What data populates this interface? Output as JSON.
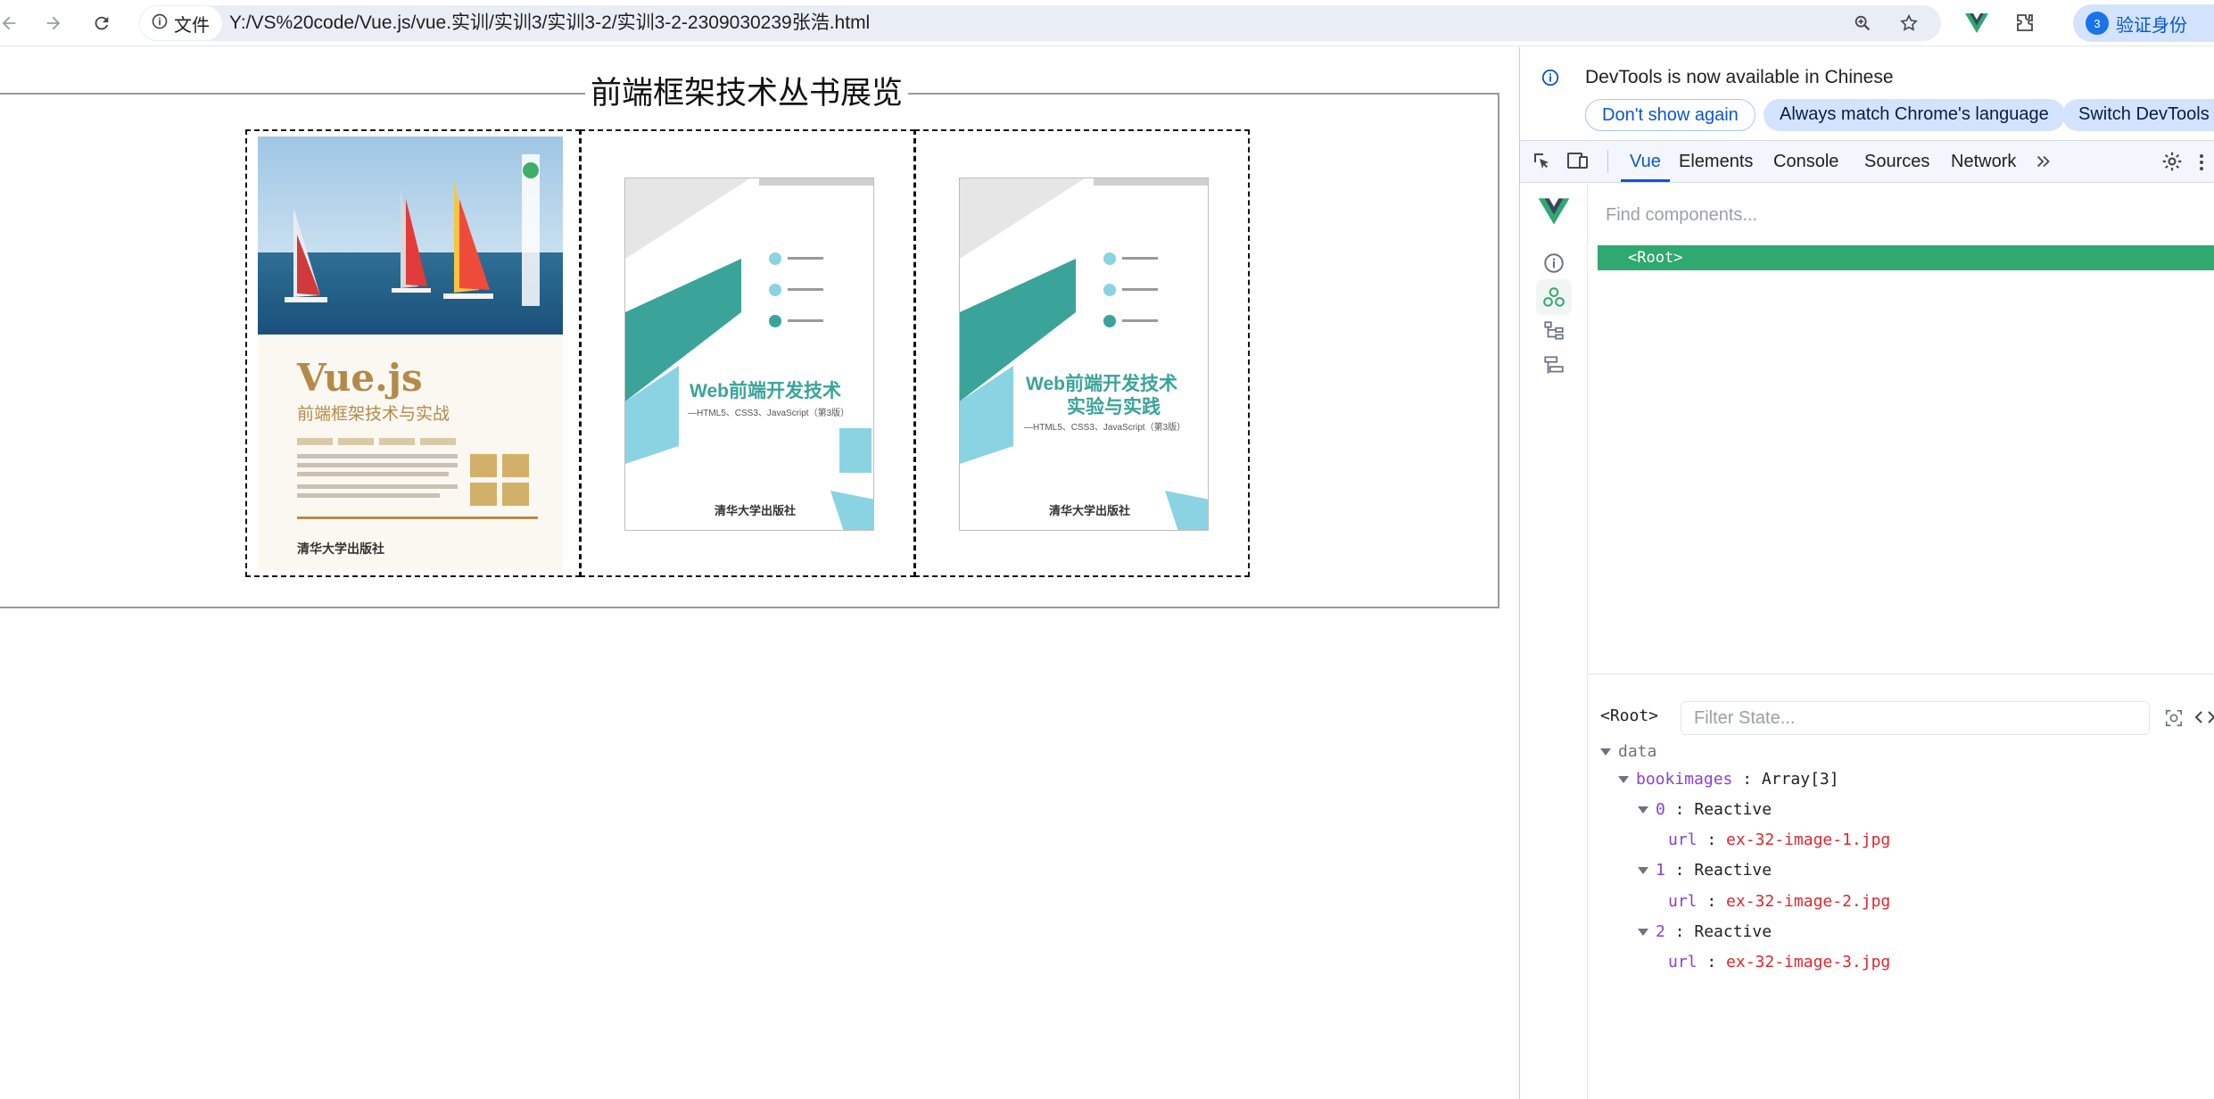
{
  "browser": {
    "site_chip_label": "文件",
    "url": "Y:/VS%20code/Vue.js/vue.实训/实训3/实训3-2/实训3-2-2309030239张浩.html",
    "profile_label": "验证身份",
    "profile_initial": "3"
  },
  "page": {
    "gallery_title": "前端框架技术丛书展览",
    "books": [
      {
        "cover_title": "Vue.js",
        "cover_subtitle": "前端框架技术与实战",
        "publisher": "清华大学出版社"
      },
      {
        "cover_title": "Web前端开发技术",
        "cover_subtitle": "—HTML5、CSS3、JavaScript（第3版）",
        "publisher": "清华大学出版社"
      },
      {
        "cover_title": "Web前端开发技术",
        "cover_title_2": "实验与实践",
        "cover_subtitle": "—HTML5、CSS3、JavaScript（第3版）",
        "publisher": "清华大学出版社"
      }
    ]
  },
  "devtools": {
    "banner_message": "DevTools is now available in Chinese",
    "banner_buttons": [
      "Don't show again",
      "Always match Chrome's language",
      "Switch DevTools t"
    ],
    "tabs": [
      "Vue",
      "Elements",
      "Console",
      "Sources",
      "Network"
    ],
    "active_tab": "Vue",
    "find_placeholder": "Find components...",
    "root_component": "<Root>",
    "state": {
      "tag": "<Root>",
      "filter_placeholder": "Filter State...",
      "section": "data",
      "array_key": "bookimages",
      "array_value": "Array[3]",
      "items": [
        {
          "index": "0",
          "type": "Reactive",
          "key": "url",
          "value": "ex-32-image-1.jpg"
        },
        {
          "index": "1",
          "type": "Reactive",
          "key": "url",
          "value": "ex-32-image-2.jpg"
        },
        {
          "index": "2",
          "type": "Reactive",
          "key": "url",
          "value": "ex-32-image-3.jpg"
        }
      ]
    }
  },
  "colors": {
    "vue_green": "#2fa96f",
    "accent_blue": "#0b57d0",
    "state_key_purple": "#8b3fd9",
    "state_value_red": "#e0262d"
  }
}
